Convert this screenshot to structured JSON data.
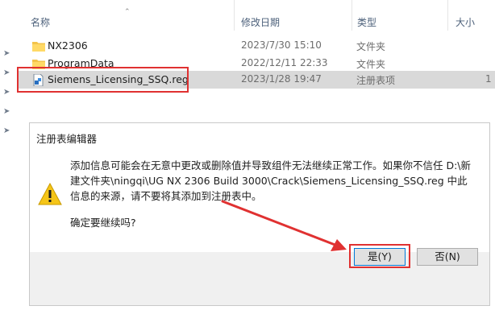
{
  "columns": {
    "name": "名称",
    "modified": "修改日期",
    "type": "类型",
    "size": "大小"
  },
  "files": [
    {
      "name": "NX2306",
      "date": "2023/7/30 15:10",
      "type": "文件夹",
      "size": "",
      "icon": "folder-icon",
      "selected": false
    },
    {
      "name": "ProgramData",
      "date": "2022/12/11 22:33",
      "type": "文件夹",
      "size": "",
      "icon": "folder-icon",
      "selected": false
    },
    {
      "name": "Siemens_Licensing_SSQ.reg",
      "date": "2023/1/28 19:47",
      "type": "注册表项",
      "size": "1",
      "icon": "registry-file-icon",
      "selected": true
    }
  ],
  "dialog": {
    "title": "注册表编辑器",
    "message": "添加信息可能会在无意中更改或删除值并导致组件无法继续正常工作。如果你不信任 D:\\新建文件夹\\ningqi\\UG NX 2306 Build 3000\\Crack\\Siemens_Licensing_SSQ.reg 中此信息的来源，请不要将其添加到注册表中。",
    "question": "确定要继续吗?",
    "yes_label": "是(Y)",
    "no_label": "否(N)",
    "icon": "warning-icon"
  },
  "colors": {
    "annotation": "#e03131",
    "selection": "#d9d9d9",
    "accent": "#0078d7"
  }
}
